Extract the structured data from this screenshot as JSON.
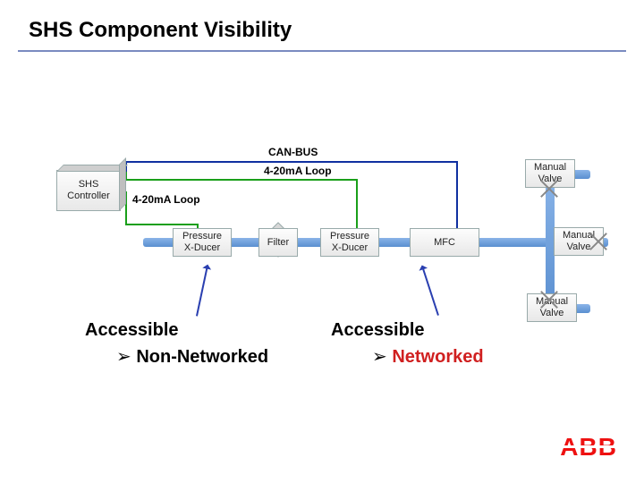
{
  "title": "SHS Component Visibility",
  "labels": {
    "canbus": "CAN-BUS",
    "loop_top": "4-20mA Loop",
    "loop_left": "4-20mA Loop"
  },
  "nodes": {
    "shs": "SHS\nController",
    "mv1": "Manual\nValve",
    "mv2": "Manual\nValve",
    "mv3": "Manual\nValve",
    "px1": "Pressure\nX-Ducer",
    "flt": "Filter",
    "px2": "Pressure\nX-Ducer",
    "mfc": "MFC"
  },
  "annot": {
    "acc1": "Accessible",
    "sub1": "Non-Networked",
    "acc2": "Accessible",
    "sub2": "Networked"
  },
  "logo": "ABB"
}
